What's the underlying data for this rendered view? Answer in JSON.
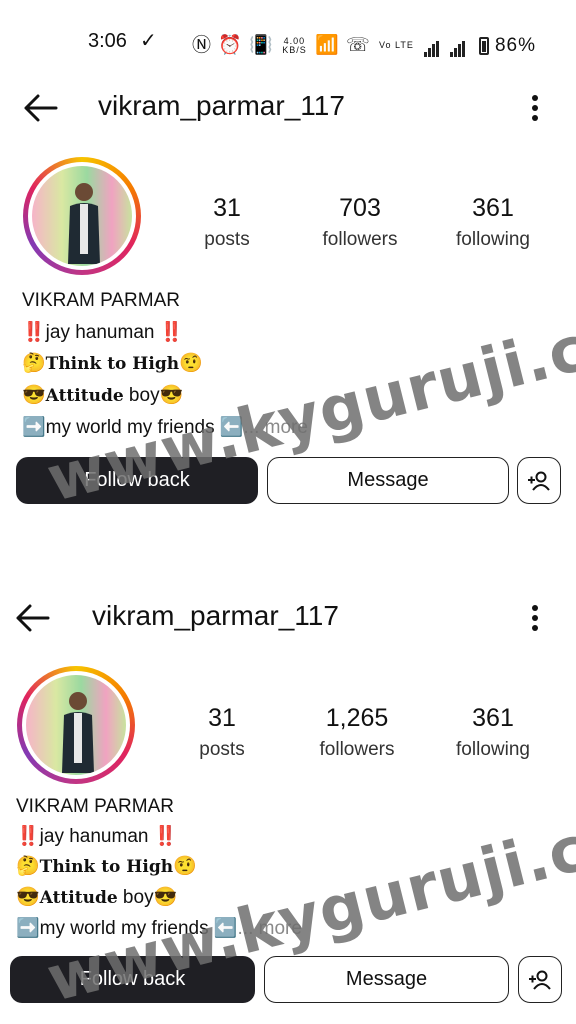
{
  "status_bar": {
    "time": "3:06",
    "network_speed_top": "4.00",
    "network_speed_bottom": "KB/S",
    "volte": "Vo LTE",
    "battery": "86%"
  },
  "profiles": [
    {
      "username": "vikram_parmar_117",
      "posts": "31",
      "posts_label": "posts",
      "followers": "703",
      "followers_label": "followers",
      "following": "361",
      "following_label": "following",
      "full_name": "VIKRAM PARMAR",
      "bio_1": "‼️jay hanuman ‼️",
      "bio_2_emoji": "🤔",
      "bio_2_text": "Think to High",
      "bio_2_emoji_end": "🤨",
      "bio_3_emoji": "😎",
      "bio_3_bold": "Attitude",
      "bio_3_text": " boy😎",
      "bio_4": "➡️my world my friends ⬅️",
      "more": "... more",
      "follow_back": "Follow back",
      "message": "Message"
    },
    {
      "username": "vikram_parmar_117",
      "posts": "31",
      "posts_label": "posts",
      "followers": "1,265",
      "followers_label": "followers",
      "following": "361",
      "following_label": "following",
      "full_name": "VIKRAM PARMAR",
      "bio_1": "‼️jay hanuman ‼️",
      "bio_2_emoji": "🤔",
      "bio_2_text": "Think to High",
      "bio_2_emoji_end": "🤨",
      "bio_3_emoji": "😎",
      "bio_3_bold": "Attitude",
      "bio_3_text": " boy😎",
      "bio_4": "➡️my world my friends ⬅️",
      "more": "... more",
      "follow_back": "Follow back",
      "message": "Message"
    }
  ],
  "watermark": "www.kyguruji.com",
  "icons": {
    "back": "back-arrow-icon",
    "menu": "more-vertical-icon",
    "add_user": "add-person-icon"
  }
}
